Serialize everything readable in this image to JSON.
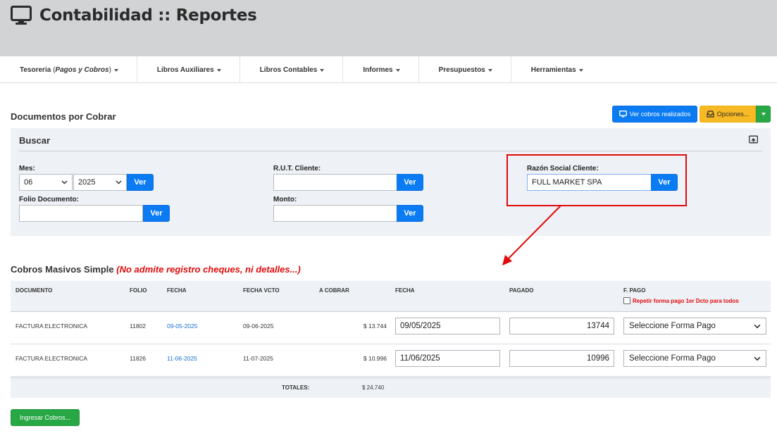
{
  "header": {
    "title": "Contabilidad :: Reportes",
    "icon": "monitor-icon"
  },
  "nav": {
    "items": [
      {
        "label": "Tesoreria",
        "sub": "Pagos y Cobros"
      },
      {
        "label": "Libros Auxiliares"
      },
      {
        "label": "Libros Contables"
      },
      {
        "label": "Informes"
      },
      {
        "label": "Presupuestos"
      },
      {
        "label": "Herramientas"
      }
    ]
  },
  "page": {
    "section_title": "Documentos por Cobrar",
    "btn_view_cobros": "Ver cobros realizados",
    "btn_options": "Opciones..."
  },
  "search": {
    "title": "Buscar",
    "mes_label": "Mes:",
    "mes_value": "06",
    "anio_value": "2025",
    "rut_label": "R.U.T. Cliente:",
    "rut_value": "",
    "razon_label": "Razón Social Cliente:",
    "razon_value": "FULL MARKET SPA",
    "folio_label": "Folio Documento:",
    "folio_value": "",
    "monto_label": "Monto:",
    "monto_value": "",
    "ver_label": "Ver"
  },
  "cobros": {
    "title": "Cobros Masivos Simple",
    "note": "(No admite registro cheques, ni detalles...)",
    "columns": {
      "documento": "DOCUMENTO",
      "folio": "FOLIO",
      "fecha": "FECHA",
      "fecha_vcto": "FECHA VCTO",
      "a_cobrar": "A COBRAR",
      "fecha_pago": "FECHA",
      "pagado": "PAGADO",
      "f_pago": "F. PAGO"
    },
    "repeat_label": "Repetir forma pago 1er Dcto para todos",
    "rows": [
      {
        "documento": "FACTURA ELECTRONICA",
        "folio": "11802",
        "fecha": "09-05-2025",
        "fecha_vcto": "09-06-2025",
        "a_cobrar": "$ 13.744",
        "fecha_pago": "09/05/2025",
        "pagado": "13744",
        "forma_pago": "Seleccione Forma Pago"
      },
      {
        "documento": "FACTURA ELECTRONICA",
        "folio": "11826",
        "fecha": "11-06-2025",
        "fecha_vcto": "11-07-2025",
        "a_cobrar": "$ 10.996",
        "fecha_pago": "11/06/2025",
        "pagado": "10996",
        "forma_pago": "Seleccione Forma Pago"
      }
    ],
    "totals_label": "TOTALES:",
    "totals_value": "$ 24.740",
    "submit_label": "Ingresar Cobros..."
  },
  "colors": {
    "primary": "#0a7bf3",
    "warning": "#f7b924",
    "success": "#28a745",
    "annotation": "#e00a0a"
  }
}
